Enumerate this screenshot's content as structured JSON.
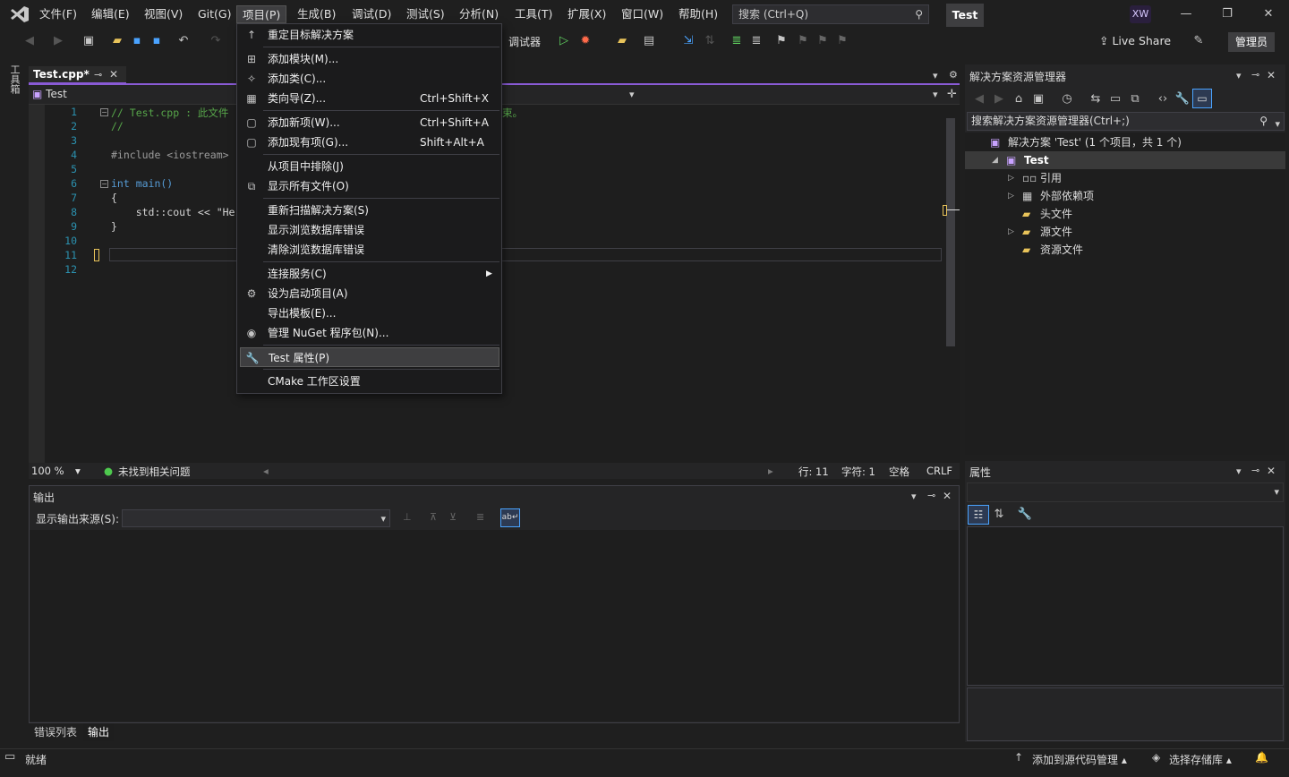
{
  "menu": {
    "items": [
      "文件(F)",
      "编辑(E)",
      "视图(V)",
      "Git(G)",
      "项目(P)",
      "生成(B)",
      "调试(D)",
      "测试(S)",
      "分析(N)",
      "工具(T)",
      "扩展(X)",
      "窗口(W)",
      "帮助(H)"
    ],
    "active_index": 4
  },
  "search": {
    "placeholder": "搜索 (Ctrl+Q)"
  },
  "solution_name": "Test",
  "user_initials": "XW",
  "toolbar": {
    "debugger_label": "调试器",
    "live_share": "Live Share",
    "admin": "管理员"
  },
  "left_strip": {
    "toolbox": "工具箱"
  },
  "editor": {
    "tab_label": "Test.cpp*",
    "nav_project": "Test",
    "lines": [
      {
        "n": "1",
        "text": "// Test.cpp : 此文件",
        "cls": "comment",
        "tail": "束。"
      },
      {
        "n": "2",
        "text": "//",
        "cls": "comment"
      },
      {
        "n": "3",
        "text": "",
        "cls": ""
      },
      {
        "n": "4",
        "text": "#include <iostream>",
        "cls": "pre"
      },
      {
        "n": "5",
        "text": "",
        "cls": ""
      },
      {
        "n": "6",
        "text": "int main()",
        "cls": "kw"
      },
      {
        "n": "7",
        "text": "{",
        "cls": ""
      },
      {
        "n": "8",
        "text": "    std::cout << \"He",
        "cls": ""
      },
      {
        "n": "9",
        "text": "}",
        "cls": ""
      },
      {
        "n": "10",
        "text": "",
        "cls": ""
      },
      {
        "n": "11",
        "text": "",
        "cls": ""
      },
      {
        "n": "12",
        "text": "",
        "cls": ""
      }
    ],
    "status": {
      "zoom": "100 %",
      "issues": "未找到相关问题",
      "line": "行: 11",
      "char": "字符: 1",
      "spaces": "空格",
      "eol": "CRLF"
    }
  },
  "project_menu": {
    "items": [
      {
        "label": "重定目标解决方案",
        "shortcut": "",
        "icon": "retarget-icon"
      },
      {
        "sep": true
      },
      {
        "label": "添加模块(M)...",
        "shortcut": "",
        "icon": "add-module-icon"
      },
      {
        "label": "添加类(C)...",
        "shortcut": "",
        "icon": "add-class-icon"
      },
      {
        "label": "类向导(Z)...",
        "shortcut": "Ctrl+Shift+X",
        "icon": "class-wizard-icon"
      },
      {
        "sep": true
      },
      {
        "label": "添加新项(W)...",
        "shortcut": "Ctrl+Shift+A",
        "icon": "add-new-item-icon"
      },
      {
        "label": "添加现有项(G)...",
        "shortcut": "Shift+Alt+A",
        "icon": "add-existing-item-icon"
      },
      {
        "sep": true
      },
      {
        "label": "从项目中排除(J)",
        "shortcut": "",
        "icon": ""
      },
      {
        "label": "显示所有文件(O)",
        "shortcut": "",
        "icon": "show-all-files-icon"
      },
      {
        "sep": true
      },
      {
        "label": "重新扫描解决方案(S)",
        "shortcut": "",
        "icon": ""
      },
      {
        "label": "显示浏览数据库错误",
        "shortcut": "",
        "icon": ""
      },
      {
        "label": "清除浏览数据库错误",
        "shortcut": "",
        "icon": ""
      },
      {
        "sep": true
      },
      {
        "label": "连接服务(C)",
        "shortcut": "",
        "icon": "",
        "submenu": true
      },
      {
        "label": "设为启动项目(A)",
        "shortcut": "",
        "icon": "gear-icon"
      },
      {
        "label": "导出模板(E)...",
        "shortcut": "",
        "icon": ""
      },
      {
        "label": "管理 NuGet 程序包(N)...",
        "shortcut": "",
        "icon": "nuget-icon"
      },
      {
        "sep": true
      },
      {
        "label": "Test 属性(P)",
        "shortcut": "",
        "icon": "wrench-icon",
        "highlight": true
      },
      {
        "sep": true
      },
      {
        "label": "CMake 工作区设置",
        "shortcut": "",
        "icon": ""
      }
    ]
  },
  "output": {
    "title": "输出",
    "source_label": "显示输出来源(S):"
  },
  "bottom_tabs": [
    "错误列表",
    "输出"
  ],
  "solution_explorer": {
    "title": "解决方案资源管理器",
    "search_placeholder": "搜索解决方案资源管理器(Ctrl+;)",
    "tree": [
      {
        "label": "解决方案 'Test' (1 个项目，共 1 个)",
        "indent": 0,
        "expander": "",
        "icon": "solution-icon"
      },
      {
        "label": "Test",
        "indent": 1,
        "expander": "◢",
        "icon": "project-icon",
        "selected": true,
        "bold": true
      },
      {
        "label": "引用",
        "indent": 2,
        "expander": "▷",
        "icon": "references-icon"
      },
      {
        "label": "外部依赖项",
        "indent": 2,
        "expander": "▷",
        "icon": "external-deps-icon"
      },
      {
        "label": "头文件",
        "indent": 2,
        "expander": "",
        "icon": "folder-icon"
      },
      {
        "label": "源文件",
        "indent": 2,
        "expander": "▷",
        "icon": "folder-icon"
      },
      {
        "label": "资源文件",
        "indent": 2,
        "expander": "",
        "icon": "folder-icon"
      }
    ]
  },
  "properties": {
    "title": "属性"
  },
  "statusbar": {
    "ready": "就绪",
    "add_to_scm": "添加到源代码管理",
    "select_repo": "选择存储库"
  },
  "colors": {
    "accent": "#8a5bd6",
    "link": "#4aa3ff"
  }
}
